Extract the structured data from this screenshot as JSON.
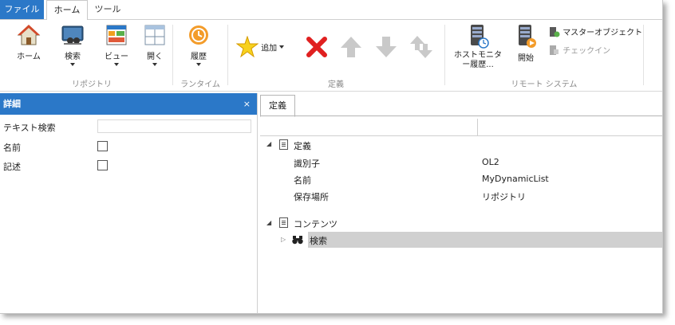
{
  "tabs": {
    "file": "ファイル",
    "home": "ホーム",
    "tools": "ツール"
  },
  "ribbon": {
    "home": "ホーム",
    "search": "検索",
    "view": "ビュー",
    "open": "開く",
    "history": "履歴",
    "add": "追加",
    "host_monitor": "ホストモニター履歴...",
    "start": "開始",
    "master_object": "マスターオブジェクト",
    "checkin": "チェックイン",
    "groups": {
      "repository": "リポジトリ",
      "runtime": "ランタイム",
      "definition": "定義",
      "remote": "リモート システム"
    }
  },
  "details": {
    "title": "詳細",
    "close": "×",
    "text_search": "テキスト検索",
    "name": "名前",
    "description": "記述"
  },
  "definition_panel": {
    "tab": "定義",
    "section_definition": "定義",
    "props": [
      {
        "key": "識別子",
        "value": "OL2"
      },
      {
        "key": "名前",
        "value": "MyDynamicList"
      },
      {
        "key": "保存場所",
        "value": "リポジトリ"
      }
    ],
    "section_contents": "コンテンツ",
    "contents_item": "検索"
  },
  "colors": {
    "accent": "#2b78c8",
    "selection": "#d0d0d0",
    "delete": "#e02020"
  },
  "icons": [
    "home-icon",
    "search-icon",
    "view-icon",
    "open-icon",
    "history-icon",
    "add-star-icon",
    "delete-icon",
    "arrow-up-icon",
    "arrow-down-icon",
    "swap-icon",
    "host-monitor-icon",
    "start-icon",
    "master-object-icon",
    "checkin-icon",
    "document-icon",
    "binoculars-icon"
  ]
}
